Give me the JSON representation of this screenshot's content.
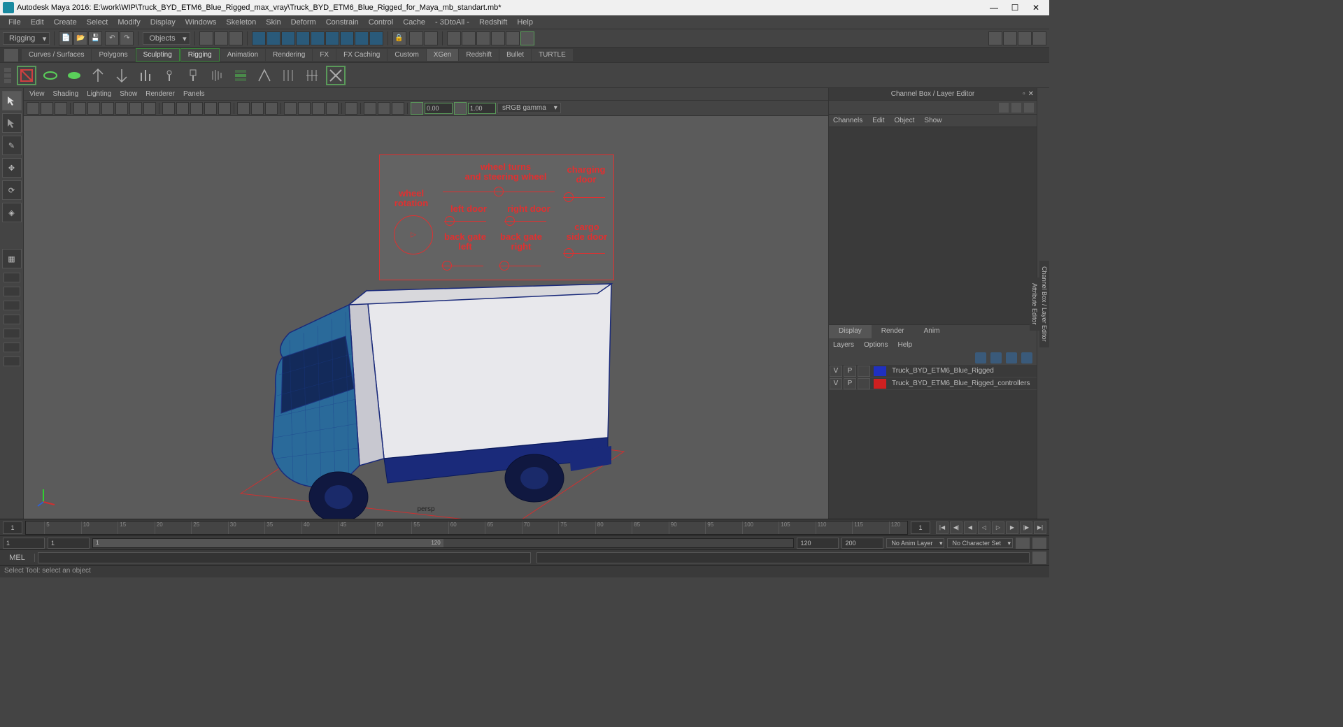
{
  "titlebar": {
    "app": "Autodesk Maya 2016:",
    "path": "E:\\work\\WIP\\Truck_BYD_ETM6_Blue_Rigged_max_vray\\Truck_BYD_ETM6_Blue_Rigged_for_Maya_mb_standart.mb*"
  },
  "menubar": [
    "File",
    "Edit",
    "Create",
    "Select",
    "Modify",
    "Display",
    "Windows",
    "Skeleton",
    "Skin",
    "Deform",
    "Constrain",
    "Control",
    "Cache",
    "- 3DtoAll -",
    "Redshift",
    "Help"
  ],
  "shelf": {
    "workspace": "Rigging",
    "objects": "Objects"
  },
  "tabs": [
    "Curves / Surfaces",
    "Polygons",
    "Sculpting",
    "Rigging",
    "Animation",
    "Rendering",
    "FX",
    "FX Caching",
    "Custom",
    "XGen",
    "Redshift",
    "Bullet",
    "TURTLE"
  ],
  "tabs_green": [
    "Sculpting",
    "Rigging"
  ],
  "tabs_active": "XGen",
  "viewport_menu": [
    "View",
    "Shading",
    "Lighting",
    "Show",
    "Renderer",
    "Panels"
  ],
  "viewport_toolbar": {
    "near": "0.00",
    "far": "1.00",
    "colorspace": "sRGB gamma"
  },
  "viewport": {
    "camera": "persp"
  },
  "rig": {
    "wheel_rotation": "wheel\nrotation",
    "wheel_turns": "wheel turns\nand steering wheel",
    "charging_door": "charging\ndoor",
    "left_door": "left door",
    "right_door": "right door",
    "back_gate_left": "back gate\nleft",
    "back_gate_right": "back gate\nright",
    "cargo_side_door": "cargo\nside door"
  },
  "channelbox": {
    "title": "Channel Box / Layer Editor",
    "menu": [
      "Channels",
      "Edit",
      "Object",
      "Show"
    ]
  },
  "layers": {
    "tabs": [
      "Display",
      "Render",
      "Anim"
    ],
    "active": "Display",
    "menu": [
      "Layers",
      "Options",
      "Help"
    ],
    "rows": [
      {
        "v": "V",
        "p": "P",
        "color": "#2030c0",
        "name": "Truck_BYD_ETM6_Blue_Rigged"
      },
      {
        "v": "V",
        "p": "P",
        "color": "#d02020",
        "name": "Truck_BYD_ETM6_Blue_Rigged_controllers"
      }
    ]
  },
  "sidetabs": [
    "Channel Box / Layer Editor",
    "Attribute Editor"
  ],
  "timeslider": {
    "start": "1",
    "end": "1",
    "ticks": [
      5,
      10,
      15,
      20,
      25,
      30,
      35,
      40,
      45,
      50,
      55,
      60,
      65,
      70,
      75,
      80,
      85,
      90,
      95,
      100,
      105,
      110,
      115,
      120
    ]
  },
  "rangeslider": {
    "start": "1",
    "inner_start": "1",
    "inner_end": "120",
    "range_end": "120",
    "outer_end": "200",
    "anim_layer": "No Anim Layer",
    "char_set": "No Character Set"
  },
  "cmdline": {
    "label": "MEL"
  },
  "helpline": {
    "text": "Select Tool: select an object"
  }
}
